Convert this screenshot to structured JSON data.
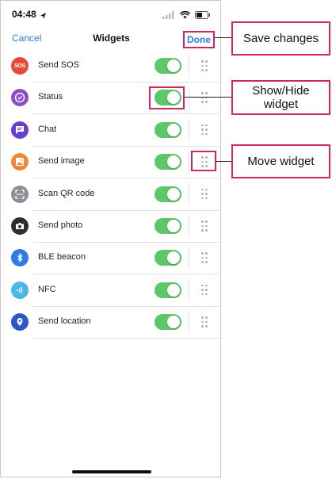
{
  "status_bar": {
    "time": "04:48"
  },
  "nav": {
    "cancel": "Cancel",
    "title": "Widgets",
    "done": "Done"
  },
  "widgets": [
    {
      "label": "Send SOS",
      "icon": "sos-icon",
      "color": "#e8493b",
      "enabled": true
    },
    {
      "label": "Status",
      "icon": "check-circle-icon",
      "color": "#8b4dc9",
      "enabled": true
    },
    {
      "label": "Chat",
      "icon": "chat-icon",
      "color": "#6a3fc9",
      "enabled": true
    },
    {
      "label": "Send image",
      "icon": "image-icon",
      "color": "#f0883a",
      "enabled": true
    },
    {
      "label": "Scan QR code",
      "icon": "qr-scan-icon",
      "color": "#8a8f98",
      "enabled": true
    },
    {
      "label": "Send photo",
      "icon": "camera-icon",
      "color": "#2b2f33",
      "enabled": true
    },
    {
      "label": "BLE beacon",
      "icon": "bluetooth-icon",
      "color": "#2f7be8",
      "enabled": true
    },
    {
      "label": "NFC",
      "icon": "nfc-icon",
      "color": "#4cb6e6",
      "enabled": true
    },
    {
      "label": "Send location",
      "icon": "location-pin-icon",
      "color": "#2b58c9",
      "enabled": true
    }
  ],
  "callouts": {
    "save": "Save changes",
    "show_hide": "Show/Hide widget",
    "move": "Move widget"
  },
  "colors": {
    "accent": "#2a7fe0",
    "toggle_on": "#5cc86a",
    "highlight": "#d1275f"
  }
}
